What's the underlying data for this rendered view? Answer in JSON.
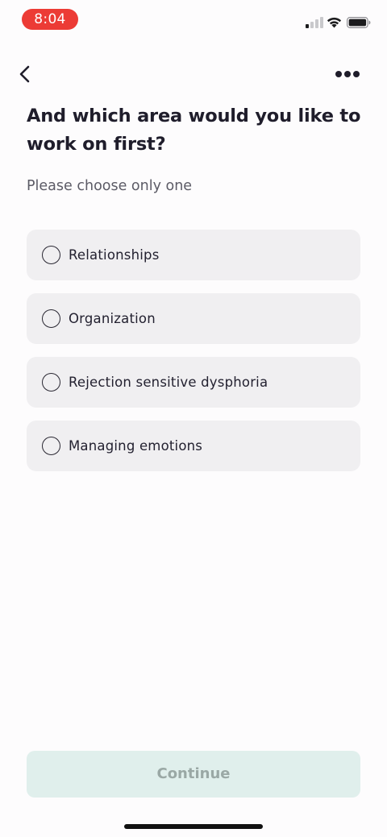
{
  "status_bar": {
    "time": "8:04",
    "time_pill_color": "#ec3b35",
    "signal_bars_active": 1,
    "icons": [
      "cellular-signal-icon",
      "wifi-icon",
      "battery-icon"
    ]
  },
  "nav": {
    "back_icon": "chevron-left-icon",
    "more_icon": "more-horizontal-icon"
  },
  "question": "And which area would you like to work on first?",
  "hint": "Please choose only one",
  "options": [
    {
      "label": "Relationships",
      "selected": false
    },
    {
      "label": "Organization",
      "selected": false
    },
    {
      "label": "Rejection sensitive dysphoria",
      "selected": false
    },
    {
      "label": "Managing emotions",
      "selected": false
    }
  ],
  "continue_label": "Continue",
  "continue_enabled": false,
  "colors": {
    "background": "#fdfcfd",
    "option_background": "#f0eff1",
    "continue_background": "#e0efec",
    "continue_text": "#9aa8a5"
  }
}
